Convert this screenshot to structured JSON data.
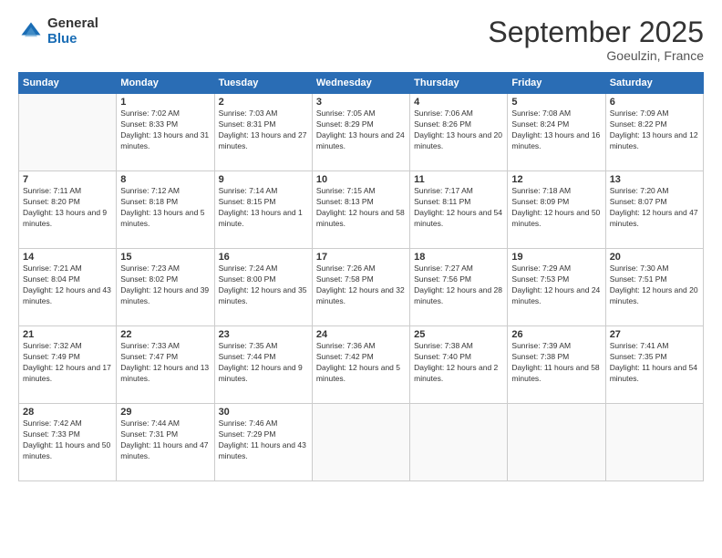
{
  "logo": {
    "general": "General",
    "blue": "Blue"
  },
  "title": "September 2025",
  "subtitle": "Goeulzin, France",
  "days_of_week": [
    "Sunday",
    "Monday",
    "Tuesday",
    "Wednesday",
    "Thursday",
    "Friday",
    "Saturday"
  ],
  "weeks": [
    [
      {
        "day": "",
        "sunrise": "",
        "sunset": "",
        "daylight": ""
      },
      {
        "day": "1",
        "sunrise": "Sunrise: 7:02 AM",
        "sunset": "Sunset: 8:33 PM",
        "daylight": "Daylight: 13 hours and 31 minutes."
      },
      {
        "day": "2",
        "sunrise": "Sunrise: 7:03 AM",
        "sunset": "Sunset: 8:31 PM",
        "daylight": "Daylight: 13 hours and 27 minutes."
      },
      {
        "day": "3",
        "sunrise": "Sunrise: 7:05 AM",
        "sunset": "Sunset: 8:29 PM",
        "daylight": "Daylight: 13 hours and 24 minutes."
      },
      {
        "day": "4",
        "sunrise": "Sunrise: 7:06 AM",
        "sunset": "Sunset: 8:26 PM",
        "daylight": "Daylight: 13 hours and 20 minutes."
      },
      {
        "day": "5",
        "sunrise": "Sunrise: 7:08 AM",
        "sunset": "Sunset: 8:24 PM",
        "daylight": "Daylight: 13 hours and 16 minutes."
      },
      {
        "day": "6",
        "sunrise": "Sunrise: 7:09 AM",
        "sunset": "Sunset: 8:22 PM",
        "daylight": "Daylight: 13 hours and 12 minutes."
      }
    ],
    [
      {
        "day": "7",
        "sunrise": "Sunrise: 7:11 AM",
        "sunset": "Sunset: 8:20 PM",
        "daylight": "Daylight: 13 hours and 9 minutes."
      },
      {
        "day": "8",
        "sunrise": "Sunrise: 7:12 AM",
        "sunset": "Sunset: 8:18 PM",
        "daylight": "Daylight: 13 hours and 5 minutes."
      },
      {
        "day": "9",
        "sunrise": "Sunrise: 7:14 AM",
        "sunset": "Sunset: 8:15 PM",
        "daylight": "Daylight: 13 hours and 1 minute."
      },
      {
        "day": "10",
        "sunrise": "Sunrise: 7:15 AM",
        "sunset": "Sunset: 8:13 PM",
        "daylight": "Daylight: 12 hours and 58 minutes."
      },
      {
        "day": "11",
        "sunrise": "Sunrise: 7:17 AM",
        "sunset": "Sunset: 8:11 PM",
        "daylight": "Daylight: 12 hours and 54 minutes."
      },
      {
        "day": "12",
        "sunrise": "Sunrise: 7:18 AM",
        "sunset": "Sunset: 8:09 PM",
        "daylight": "Daylight: 12 hours and 50 minutes."
      },
      {
        "day": "13",
        "sunrise": "Sunrise: 7:20 AM",
        "sunset": "Sunset: 8:07 PM",
        "daylight": "Daylight: 12 hours and 47 minutes."
      }
    ],
    [
      {
        "day": "14",
        "sunrise": "Sunrise: 7:21 AM",
        "sunset": "Sunset: 8:04 PM",
        "daylight": "Daylight: 12 hours and 43 minutes."
      },
      {
        "day": "15",
        "sunrise": "Sunrise: 7:23 AM",
        "sunset": "Sunset: 8:02 PM",
        "daylight": "Daylight: 12 hours and 39 minutes."
      },
      {
        "day": "16",
        "sunrise": "Sunrise: 7:24 AM",
        "sunset": "Sunset: 8:00 PM",
        "daylight": "Daylight: 12 hours and 35 minutes."
      },
      {
        "day": "17",
        "sunrise": "Sunrise: 7:26 AM",
        "sunset": "Sunset: 7:58 PM",
        "daylight": "Daylight: 12 hours and 32 minutes."
      },
      {
        "day": "18",
        "sunrise": "Sunrise: 7:27 AM",
        "sunset": "Sunset: 7:56 PM",
        "daylight": "Daylight: 12 hours and 28 minutes."
      },
      {
        "day": "19",
        "sunrise": "Sunrise: 7:29 AM",
        "sunset": "Sunset: 7:53 PM",
        "daylight": "Daylight: 12 hours and 24 minutes."
      },
      {
        "day": "20",
        "sunrise": "Sunrise: 7:30 AM",
        "sunset": "Sunset: 7:51 PM",
        "daylight": "Daylight: 12 hours and 20 minutes."
      }
    ],
    [
      {
        "day": "21",
        "sunrise": "Sunrise: 7:32 AM",
        "sunset": "Sunset: 7:49 PM",
        "daylight": "Daylight: 12 hours and 17 minutes."
      },
      {
        "day": "22",
        "sunrise": "Sunrise: 7:33 AM",
        "sunset": "Sunset: 7:47 PM",
        "daylight": "Daylight: 12 hours and 13 minutes."
      },
      {
        "day": "23",
        "sunrise": "Sunrise: 7:35 AM",
        "sunset": "Sunset: 7:44 PM",
        "daylight": "Daylight: 12 hours and 9 minutes."
      },
      {
        "day": "24",
        "sunrise": "Sunrise: 7:36 AM",
        "sunset": "Sunset: 7:42 PM",
        "daylight": "Daylight: 12 hours and 5 minutes."
      },
      {
        "day": "25",
        "sunrise": "Sunrise: 7:38 AM",
        "sunset": "Sunset: 7:40 PM",
        "daylight": "Daylight: 12 hours and 2 minutes."
      },
      {
        "day": "26",
        "sunrise": "Sunrise: 7:39 AM",
        "sunset": "Sunset: 7:38 PM",
        "daylight": "Daylight: 11 hours and 58 minutes."
      },
      {
        "day": "27",
        "sunrise": "Sunrise: 7:41 AM",
        "sunset": "Sunset: 7:35 PM",
        "daylight": "Daylight: 11 hours and 54 minutes."
      }
    ],
    [
      {
        "day": "28",
        "sunrise": "Sunrise: 7:42 AM",
        "sunset": "Sunset: 7:33 PM",
        "daylight": "Daylight: 11 hours and 50 minutes."
      },
      {
        "day": "29",
        "sunrise": "Sunrise: 7:44 AM",
        "sunset": "Sunset: 7:31 PM",
        "daylight": "Daylight: 11 hours and 47 minutes."
      },
      {
        "day": "30",
        "sunrise": "Sunrise: 7:46 AM",
        "sunset": "Sunset: 7:29 PM",
        "daylight": "Daylight: 11 hours and 43 minutes."
      },
      {
        "day": "",
        "sunrise": "",
        "sunset": "",
        "daylight": ""
      },
      {
        "day": "",
        "sunrise": "",
        "sunset": "",
        "daylight": ""
      },
      {
        "day": "",
        "sunrise": "",
        "sunset": "",
        "daylight": ""
      },
      {
        "day": "",
        "sunrise": "",
        "sunset": "",
        "daylight": ""
      }
    ]
  ]
}
